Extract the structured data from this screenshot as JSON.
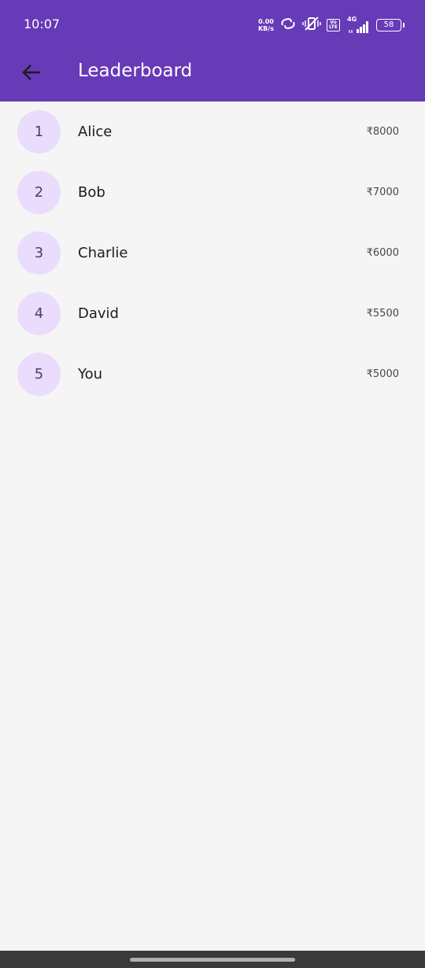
{
  "status_bar": {
    "time": "10:07",
    "net_speed_value": "0.00",
    "net_speed_unit": "KB/s",
    "volte_top": "Vo",
    "volte_bottom": "LTE",
    "network_type": "4G",
    "battery_level": "58"
  },
  "app_bar": {
    "title": "Leaderboard",
    "back_icon": "arrow-back-icon",
    "background": "#673ab7"
  },
  "leaderboard": [
    {
      "rank": "1",
      "name": "Alice",
      "amount": "₹8000"
    },
    {
      "rank": "2",
      "name": "Bob",
      "amount": "₹7000"
    },
    {
      "rank": "3",
      "name": "Charlie",
      "amount": "₹6000"
    },
    {
      "rank": "4",
      "name": "David",
      "amount": "₹5500"
    },
    {
      "rank": "5",
      "name": "You",
      "amount": "₹5000"
    }
  ],
  "colors": {
    "rank_circle": "#eadcfc",
    "page_background": "#f5f5f5"
  }
}
